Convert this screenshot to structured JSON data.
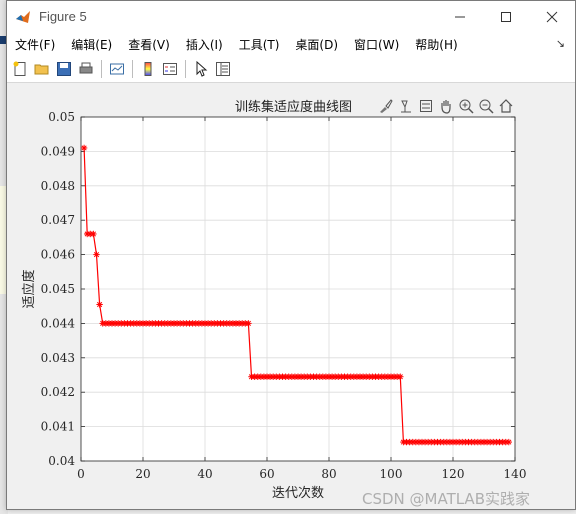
{
  "window": {
    "title": "Figure 5"
  },
  "menu": {
    "items": [
      "文件(F)",
      "编辑(E)",
      "查看(V)",
      "插入(I)",
      "工具(T)",
      "桌面(D)",
      "窗口(W)",
      "帮助(H)"
    ]
  },
  "toolbar": {
    "buttons": [
      "new-figure-icon",
      "open-folder-icon",
      "save-icon",
      "print-icon",
      "link-plot-icon",
      "colorbar-icon",
      "legend-icon",
      "pointer-icon",
      "property-editor-icon"
    ]
  },
  "axes_toolbar": {
    "buttons": [
      "brush-icon",
      "data-tips-icon",
      "pan-icon",
      "zoom-in-icon",
      "zoom-out-icon",
      "home-icon"
    ]
  },
  "colors": {
    "series": "#ff0000",
    "grid": "#dcdcdc"
  },
  "watermark": "CSDN @MATLAB实践家",
  "chart_data": {
    "type": "line",
    "title": "训练集适应度曲线图",
    "xlabel": "迭代次数",
    "ylabel": "适应度",
    "xlim": [
      0,
      140
    ],
    "ylim": [
      0.04,
      0.05
    ],
    "xticks": [
      "0",
      "20",
      "40",
      "60",
      "80",
      "100",
      "120",
      "140"
    ],
    "yticks": [
      "0.04",
      "0.041",
      "0.042",
      "0.043",
      "0.044",
      "0.045",
      "0.046",
      "0.047",
      "0.048",
      "0.049",
      "0.05"
    ],
    "grid": true,
    "marker": "*",
    "series": [
      {
        "segments": [
          {
            "from": 1,
            "to": 1,
            "value": 0.0491
          },
          {
            "from": 2,
            "to": 4,
            "value": 0.0466
          },
          {
            "from": 5,
            "to": 5,
            "value": 0.046
          },
          {
            "from": 6,
            "to": 6,
            "value": 0.04455
          },
          {
            "from": 7,
            "to": 54,
            "value": 0.044
          },
          {
            "from": 55,
            "to": 103,
            "value": 0.04245
          },
          {
            "from": 104,
            "to": 138,
            "value": 0.04055
          }
        ]
      }
    ]
  }
}
